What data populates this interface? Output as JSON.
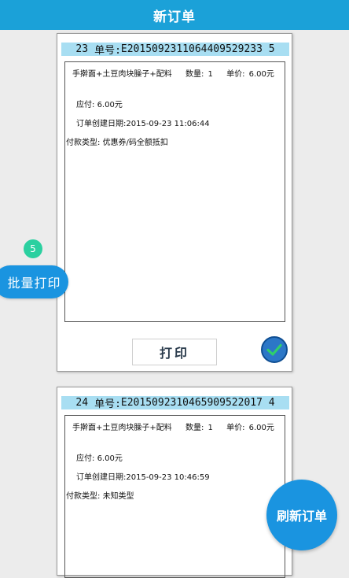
{
  "header": {
    "title": "新订单"
  },
  "orders": [
    {
      "index": "23",
      "order_no_label": "单号:",
      "order_no": "E2015092311064409529233 5",
      "item_name": "手擀面+土豆肉块臊子+配料",
      "qty_label": "数量:",
      "qty": "1",
      "price_label": "单价:",
      "price": "6.00元",
      "amount_label": "应付:",
      "amount": "6.00元",
      "date_label": "订单创建日期:",
      "date": "2015-09-23 11:06:44",
      "payment_label": "付款类型:",
      "payment": "优惠券/码全额抵扣",
      "print_label": "打印"
    },
    {
      "index": "24",
      "order_no_label": "单号:",
      "order_no": "E2015092310465909522017 4",
      "item_name": "手擀面+土豆肉块臊子+配料",
      "qty_label": "数量:",
      "qty": "1",
      "price_label": "单价:",
      "price": "6.00元",
      "amount_label": "应付:",
      "amount": "6.00元",
      "date_label": "订单创建日期:",
      "date": "2015-09-23 10:46:59",
      "payment_label": "付款类型:",
      "payment": "未知类型"
    }
  ],
  "batch_print": {
    "count": "5",
    "label": "批量打印"
  },
  "refresh": {
    "label": "刷新订单"
  },
  "colors": {
    "header_bg": "#1ba1d8",
    "order_no_bg": "#a8def2",
    "fab_bg": "#1a94e0",
    "count_badge_bg": "#2bd0a0"
  },
  "icons": {
    "checked": "check-circle-icon"
  }
}
